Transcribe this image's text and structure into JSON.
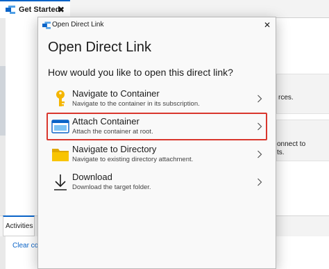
{
  "app": {
    "tab": {
      "label": "Get Started",
      "close": "✖"
    },
    "right_cards": [
      {
        "text": "rces."
      },
      {
        "line1": "onnect to",
        "line2": "ts."
      }
    ],
    "activities": {
      "label": "Activities",
      "clear_link": "Clear completed"
    }
  },
  "dialog": {
    "title": "Open Direct Link",
    "close_symbol": "✕",
    "heading": "Open Direct Link",
    "question": "How would you like to open this direct link?",
    "options": [
      {
        "title": "Navigate to Container",
        "description": "Navigate to the container in its subscription.",
        "icon": "key-icon",
        "selected": false
      },
      {
        "title": "Attach Container",
        "description": "Attach the container at root.",
        "icon": "container-window-icon",
        "selected": true
      },
      {
        "title": "Navigate to Directory",
        "description": "Navigate to existing directory attachment.",
        "icon": "folder-icon",
        "selected": false
      },
      {
        "title": "Download",
        "description": "Download the target folder.",
        "icon": "download-arrow-icon",
        "selected": false
      }
    ]
  },
  "colors": {
    "accent": "#0a64c8",
    "selection_border": "#d9362d",
    "key_gold": "#f4b500",
    "folder_yellow": "#f8c400"
  }
}
